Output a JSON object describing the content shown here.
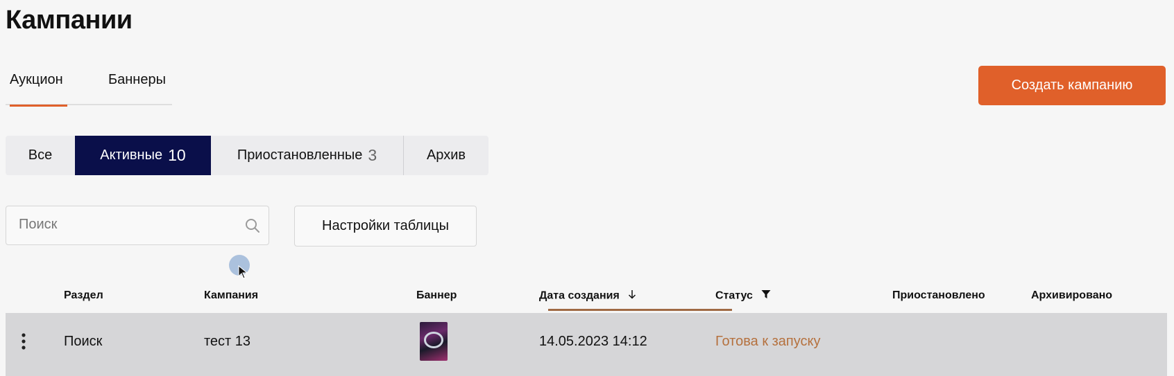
{
  "page": {
    "title": "Кампании"
  },
  "tabs": [
    {
      "label": "Аукцион",
      "active": true
    },
    {
      "label": "Баннеры",
      "active": false
    }
  ],
  "create_button": {
    "label": "Создать кампанию",
    "color": "#e0602a"
  },
  "filters": {
    "all": {
      "label": "Все"
    },
    "active": {
      "label": "Активные",
      "count": "10"
    },
    "paused": {
      "label": "Приостановленные",
      "count": "3"
    },
    "archive": {
      "label": "Архив"
    },
    "active_color": "#0a0f4a"
  },
  "search": {
    "placeholder": "Поиск",
    "icon": "search-icon"
  },
  "table_settings_button": {
    "label": "Настройки таблицы"
  },
  "table": {
    "columns": {
      "section": "Раздел",
      "campaign": "Кампания",
      "banner": "Баннер",
      "created": "Дата создания",
      "status": "Статус",
      "paused": "Приостановлено",
      "archived": "Архивировано"
    },
    "sorted_by": "created",
    "rows": [
      {
        "section": "Поиск",
        "campaign": "тест 13",
        "created": "14.05.2023 14:12",
        "status": "Готова к запуску",
        "status_color": "#b5713e",
        "paused": "",
        "archived": ""
      }
    ]
  }
}
